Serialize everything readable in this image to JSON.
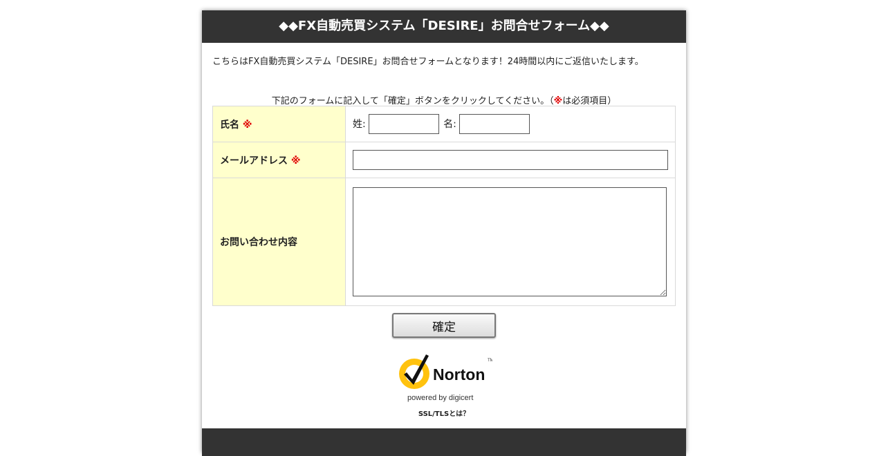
{
  "header": {
    "title": "◆◆FX自動売買システム「DESIRE」お問合せフォーム◆◆"
  },
  "intro": {
    "text": "こちらはFX自動売買システム「DESIRE」お問合せフォームとなります！24時間以内にご返信いたします。"
  },
  "instruction": {
    "before": "下記のフォームに記入して「確定」ボタンをクリックしてください。（",
    "mark": "※",
    "after": "は必須項目）"
  },
  "form": {
    "required_mark": "※",
    "name": {
      "label": "氏名",
      "last_label": "姓:",
      "first_label": "名:",
      "last_value": "",
      "first_value": ""
    },
    "email": {
      "label": "メールアドレス",
      "value": ""
    },
    "message": {
      "label": "お問い合わせ内容",
      "value": ""
    },
    "submit_label": "確定"
  },
  "seal": {
    "brand": "Norton",
    "powered_by": "powered by digicert",
    "ssl_link": "SSL/TLSとは？"
  },
  "colors": {
    "header_bg": "#333333",
    "label_bg": "#ffffcc",
    "required": "#e00000",
    "norton_yellow": "#ffc20e"
  }
}
